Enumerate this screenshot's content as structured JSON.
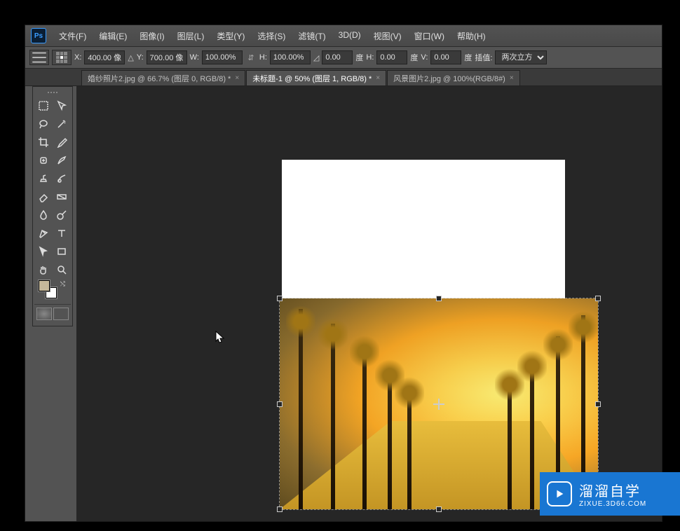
{
  "app": {
    "logo_text": "Ps"
  },
  "menu": {
    "file": "文件(F)",
    "edit": "编辑(E)",
    "image": "图像(I)",
    "layer": "图层(L)",
    "type": "类型(Y)",
    "select": "选择(S)",
    "filter": "滤镜(T)",
    "threed": "3D(D)",
    "view": "视图(V)",
    "window": "窗口(W)",
    "help": "帮助(H)"
  },
  "options": {
    "x_label": "X:",
    "x_value": "400.00 像",
    "y_label": "Y:",
    "y_value": "700.00 像",
    "w_label": "W:",
    "w_value": "100.00%",
    "h_label": "H:",
    "h_value": "100.00%",
    "angle_value": "0.00",
    "angle_unit": "度",
    "h2_label": "H:",
    "h2_value": "0.00",
    "h2_unit": "度",
    "v_label": "V:",
    "v_value": "0.00",
    "v_unit": "度",
    "interp_label": "插值:",
    "interp_value": "两次立方"
  },
  "tabs": {
    "t1": "婚纱照片2.jpg @ 66.7% (图层 0, RGB/8) *",
    "t2": "未标题-1 @ 50% (图层 1, RGB/8) *",
    "t3": "风景图片2.jpg @ 100%(RGB/8#)",
    "close": "×"
  },
  "watermark": {
    "main": "溜溜自学",
    "sub": "ZIXUE.3D66.COM"
  }
}
